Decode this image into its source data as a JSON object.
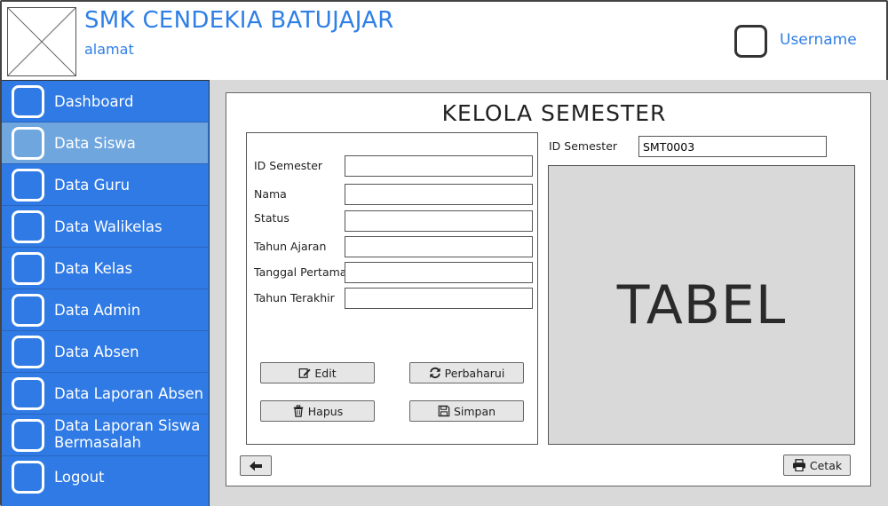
{
  "header": {
    "school_name": "SMK CENDEKIA BATUJAJAR",
    "address": "alamat",
    "username": "Username"
  },
  "sidebar": {
    "items": [
      {
        "label": "Dashboard",
        "active": false
      },
      {
        "label": "Data Siswa",
        "active": true
      },
      {
        "label": "Data Guru",
        "active": false
      },
      {
        "label": "Data Walikelas",
        "active": false
      },
      {
        "label": "Data Kelas",
        "active": false
      },
      {
        "label": "Data Admin",
        "active": false
      },
      {
        "label": "Data Absen",
        "active": false
      },
      {
        "label": "Data Laporan Absen",
        "active": false
      },
      {
        "label": "Data Laporan Siswa Bermasalah",
        "active": false
      },
      {
        "label": "Logout",
        "active": false
      }
    ]
  },
  "main": {
    "title": "KELOLA SEMESTER",
    "form": {
      "fields": [
        {
          "label": "ID Semester",
          "value": ""
        },
        {
          "label": "Nama",
          "value": ""
        },
        {
          "label": "Status",
          "value": ""
        },
        {
          "label": "Tahun Ajaran",
          "value": ""
        },
        {
          "label": "Tanggal Pertama",
          "value": ""
        },
        {
          "label": "Tahun Terakhir",
          "value": ""
        }
      ],
      "buttons": {
        "edit": "Edit",
        "refresh": "Perbaharui",
        "delete": "Hapus",
        "save": "Simpan"
      }
    },
    "search": {
      "label": "ID Semester",
      "value": "SMT0003"
    },
    "table_placeholder": "TABEL",
    "print_label": "Cetak"
  },
  "icons": {
    "edit": "edit-icon",
    "refresh": "refresh-icon",
    "delete": "trash-icon",
    "save": "save-icon",
    "back": "arrow-left-icon",
    "print": "printer-icon"
  },
  "colors": {
    "accent": "#2f7fe6",
    "sidebar": "#2f7ae4",
    "sidebar_active": "#6fa6de",
    "content_bg": "#d9d9d9"
  }
}
